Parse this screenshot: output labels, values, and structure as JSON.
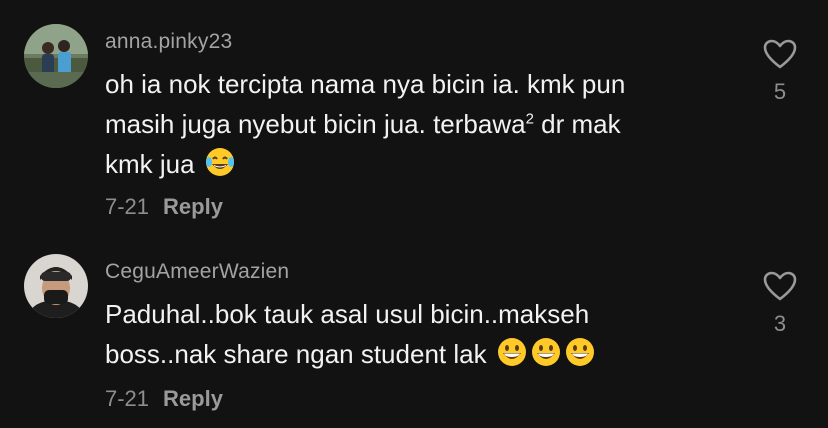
{
  "comments": [
    {
      "username": "anna.pinky23",
      "lines": [
        "oh ia nok tercipta nama nya bicin ia. kmk pun",
        "masih juga nyebut bicin jua. terbawa",
        "kmk jua"
      ],
      "superscript": "2",
      "line2_tail": " dr mak",
      "emojis": [
        "face-with-tears-of-joy"
      ],
      "date": "7-21",
      "reply_label": "Reply",
      "likes": "5"
    },
    {
      "username": "CeguAmeerWazien",
      "lines": [
        "Paduhal..bok tauk asal usul bicin..makseh",
        "boss..nak share ngan student lak"
      ],
      "emojis": [
        "grinning-face",
        "grinning-face",
        "grinning-face"
      ],
      "date": "7-21",
      "reply_label": "Reply",
      "likes": "3"
    }
  ],
  "colors": {
    "background": "#121212",
    "username": "#a3a3a3",
    "text": "#f2f2f2",
    "meta": "#8e8e8e",
    "emoji_yellow": "#ffca28"
  }
}
